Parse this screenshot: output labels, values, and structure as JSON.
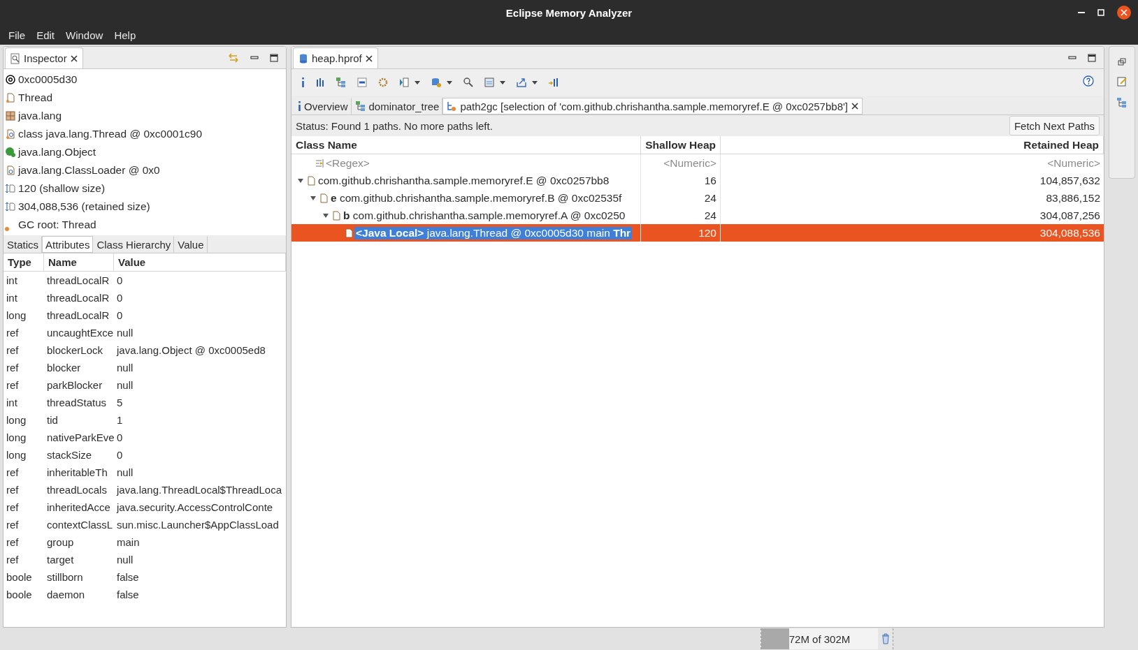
{
  "window": {
    "title": "Eclipse Memory Analyzer"
  },
  "menu": [
    "File",
    "Edit",
    "Window",
    "Help"
  ],
  "inspector": {
    "title": "Inspector",
    "items": [
      {
        "kind": "address",
        "text": "0xc0005d30"
      },
      {
        "kind": "class",
        "text": "Thread"
      },
      {
        "kind": "package",
        "text": "java.lang"
      },
      {
        "kind": "classobject",
        "text": "class java.lang.Thread @ 0xc0001c90"
      },
      {
        "kind": "superclass",
        "text": "java.lang.Object"
      },
      {
        "kind": "loader",
        "text": "java.lang.ClassLoader @ 0x0"
      },
      {
        "kind": "size",
        "text": "120 (shallow size)"
      },
      {
        "kind": "size",
        "text": "304,088,536 (retained size)"
      },
      {
        "kind": "gcroot",
        "text": "GC root: Thread"
      }
    ],
    "tabs": [
      {
        "label": "Statics",
        "selected": false
      },
      {
        "label": "Attributes",
        "selected": true
      },
      {
        "label": "Class Hierarchy",
        "selected": false
      },
      {
        "label": "Value",
        "selected": false
      }
    ],
    "columns": [
      "Type",
      "Name",
      "Value"
    ],
    "rows": [
      [
        "int",
        "threadLocalR",
        "0"
      ],
      [
        "int",
        "threadLocalR",
        "0"
      ],
      [
        "long",
        "threadLocalR",
        "0"
      ],
      [
        "ref",
        "uncaughtExce",
        "null"
      ],
      [
        "ref",
        "blockerLock",
        "java.lang.Object @ 0xc0005ed8"
      ],
      [
        "ref",
        "blocker",
        "null"
      ],
      [
        "ref",
        "parkBlocker",
        "null"
      ],
      [
        "int",
        "threadStatus",
        "5"
      ],
      [
        "long",
        "tid",
        "1"
      ],
      [
        "long",
        "nativeParkEve",
        "0"
      ],
      [
        "long",
        "stackSize",
        "0"
      ],
      [
        "ref",
        "inheritableTh",
        "null"
      ],
      [
        "ref",
        "threadLocals",
        "java.lang.ThreadLocal$ThreadLoca"
      ],
      [
        "ref",
        "inheritedAcce",
        "java.security.AccessControlConte"
      ],
      [
        "ref",
        "contextClassL",
        "sun.misc.Launcher$AppClassLoad"
      ],
      [
        "ref",
        "group",
        "main"
      ],
      [
        "ref",
        "target",
        "null"
      ],
      [
        "boole",
        "stillborn",
        "false"
      ],
      [
        "boole",
        "daemon",
        "false"
      ]
    ]
  },
  "editor": {
    "title": "heap.hprof",
    "tabs": [
      {
        "kind": "info",
        "label": "Overview",
        "selected": false,
        "closable": false
      },
      {
        "kind": "tree",
        "label": "dominator_tree",
        "selected": false,
        "closable": false
      },
      {
        "kind": "path",
        "label": "path2gc  [selection of 'com.github.chrishantha.sample.memoryref.E @ 0xc0257bb8']",
        "selected": true,
        "closable": true
      }
    ],
    "status": "Status:  Found 1 paths. No more paths left.",
    "fetch_button": "Fetch Next Paths",
    "columns": [
      "Class Name",
      "Shallow Heap",
      "Retained Heap"
    ],
    "filter": {
      "name": "<Regex>",
      "shallow": "<Numeric>",
      "retained": "<Numeric>"
    },
    "rows": [
      {
        "label": "com.github.chrishantha.sample.memoryref.E @ 0xc0257bb8",
        "shallow": "16",
        "retained": "104,857,632",
        "expanded": true,
        "selected": false,
        "children": [
          {
            "label": "**e** com.github.chrishantha.sample.memoryref.B @ 0xc02535f",
            "shallow": "24",
            "retained": "83,886,152",
            "expanded": true,
            "selected": false,
            "children": [
              {
                "label": "**b** com.github.chrishantha.sample.memoryref.A @ 0xc0250",
                "shallow": "24",
                "retained": "304,087,256",
                "expanded": true,
                "selected": false,
                "children": [
                  {
                    "label": "**<Java Local>** java.lang.Thread @ 0xc0005d30  main **Thr**",
                    "shallow": "120",
                    "retained": "304,088,536",
                    "selected": true
                  }
                ]
              }
            ]
          }
        ]
      }
    ]
  },
  "status_bar": {
    "memory": "72M of 302M",
    "level": 0.24
  }
}
